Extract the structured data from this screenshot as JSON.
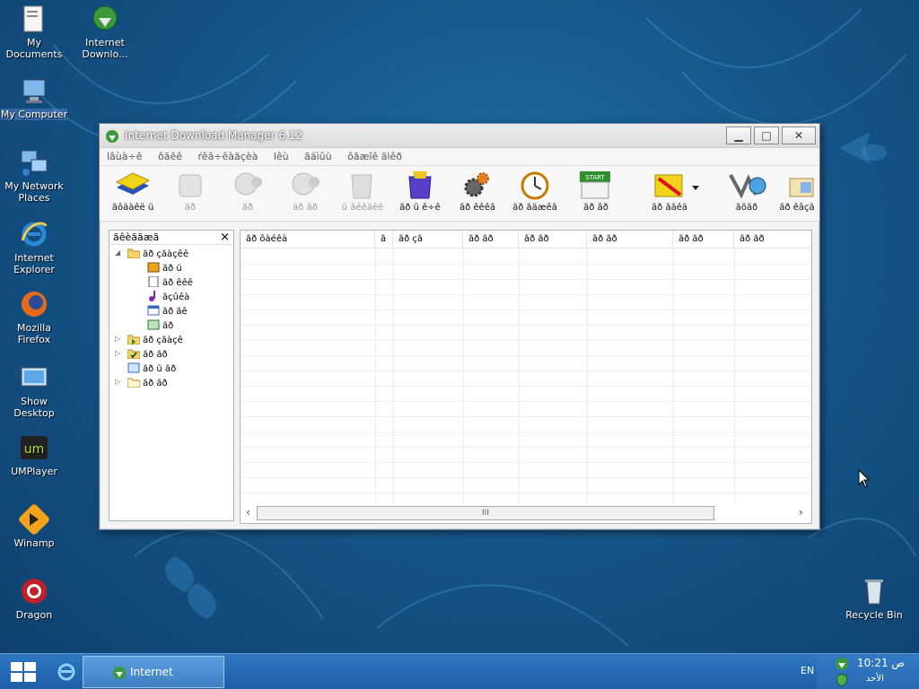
{
  "desktop": {
    "icons": [
      {
        "label": "My Documents"
      },
      {
        "label": "Internet Downlo..."
      },
      {
        "label": "My Computer"
      },
      {
        "label": "My Network Places"
      },
      {
        "label": "Internet Explorer"
      },
      {
        "label": "Mozilla Firefox"
      },
      {
        "label": "Show Desktop"
      },
      {
        "label": "UMPlayer"
      },
      {
        "label": "Winamp"
      },
      {
        "label": "Dragon"
      },
      {
        "label": "Recycle Bin"
      }
    ]
  },
  "window": {
    "title": "Internet Download Manager 6.12",
    "menu": [
      "lâùà÷ê",
      "ôãêê",
      "ŕêâ÷êàäçèà",
      "lêù",
      "ãáìûù",
      "ôãæîê ãìêð"
    ],
    "toolbar": [
      {
        "label": "ãôäàêë ŭ",
        "icon": "add-url-icon",
        "disabled": false
      },
      {
        "label": "ãð",
        "icon": "resume-icon",
        "disabled": true
      },
      {
        "label": "ãð",
        "icon": "stop-icon",
        "disabled": true
      },
      {
        "label": "ãð ãð",
        "icon": "stop-all-icon",
        "disabled": true
      },
      {
        "label": "ŭ ãêêäêê",
        "icon": "delete-icon",
        "disabled": true
      },
      {
        "label": "ãð ŭ ê÷ê",
        "icon": "delete-completed-icon",
        "disabled": false
      },
      {
        "label": "ãð êêêã",
        "icon": "options-icon",
        "disabled": false
      },
      {
        "label": "ãð ãäæêã",
        "icon": "scheduler-icon",
        "disabled": false
      },
      {
        "label": "ãð ãð",
        "icon": "start-queue-icon",
        "disabled": false
      },
      {
        "label": "ãð ãâêä",
        "icon": "stop-queue-icon",
        "disabled": false
      },
      {
        "label": "ãõãð",
        "icon": "grabber-icon",
        "disabled": false
      },
      {
        "label": "ãð êâçã",
        "icon": "tell-friend-icon",
        "disabled": false
      }
    ],
    "tree": {
      "header": "ãêèãäæã",
      "close": "×",
      "items": [
        {
          "label": "ãð çãàçêê",
          "level": 0
        },
        {
          "label": "ãð ŭ",
          "level": 1
        },
        {
          "label": "ãð êêê",
          "level": 1
        },
        {
          "label": "ãçûêà",
          "level": 1
        },
        {
          "label": "ãð ãê",
          "level": 1
        },
        {
          "label": "ãð",
          "level": 1
        },
        {
          "label": "ãð çãàçê",
          "level": 0
        },
        {
          "label": "ãð ãð",
          "level": 0
        },
        {
          "label": "ãð ŭ ãð",
          "level": 0
        },
        {
          "label": "ãð ãð",
          "level": 0
        }
      ]
    },
    "columns": [
      "ãð ôàéêà",
      "ã",
      "ãð çã",
      "ãð ãð",
      "ãð ãð",
      "ãð ãð",
      "ãð ãð",
      "ãð ãð"
    ],
    "scroll_thumb": "III"
  },
  "taskbar": {
    "task_label": "Internet Downlo...",
    "lang": "EN",
    "time": "10:21 ص",
    "date": "الأحد"
  }
}
